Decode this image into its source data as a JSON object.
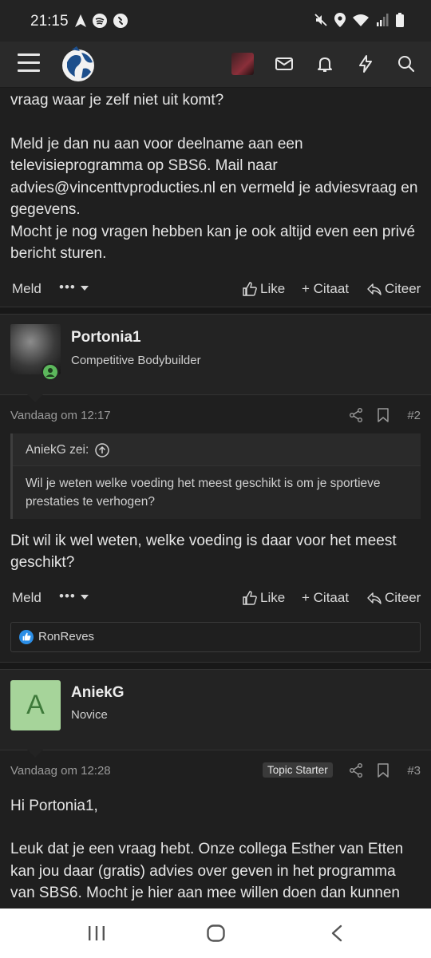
{
  "status_bar": {
    "time": "21:15",
    "left_icons": [
      "navigation-arrow-icon",
      "spotify-icon",
      "shazam-icon"
    ],
    "right_icons": [
      "mute-icon",
      "location-icon",
      "wifi-icon",
      "signal-icon",
      "battery-icon"
    ]
  },
  "top_nav": {
    "icons": [
      "menu-icon",
      "site-logo",
      "user-avatar",
      "inbox-icon",
      "bell-icon",
      "lightning-icon",
      "search-icon"
    ]
  },
  "post1": {
    "text_top": "vraag waar je zelf niet uit komt?",
    "text_body": "Meld je dan nu aan voor deelname aan een televisieprogramma op SBS6. Mail naar advies@vincenttvproducties.nl en vermeld je adviesvraag en gegevens.",
    "text_body2": "Mocht je nog vragen hebben kan je ook altijd even een privé bericht sturen.",
    "actions": {
      "report": "Meld",
      "more": "•••",
      "like": "Like",
      "quote": "+ Citaat",
      "reply": "Citeer"
    }
  },
  "post2": {
    "username": "Portonia1",
    "rank": "Competitive Bodybuilder",
    "date": "Vandaag om 12:17",
    "number": "#2",
    "quote_author": "AniekG zei:",
    "quote_text": "Wil je weten welke voeding het meest geschikt is om je sportieve prestaties te verhogen?",
    "text": "Dit wil ik wel weten, welke voeding is daar voor het meest geschikt?",
    "actions": {
      "report": "Meld",
      "more": "•••",
      "like": "Like",
      "quote": "+ Citaat",
      "reply": "Citeer"
    },
    "reaction_user": "RonReves"
  },
  "post3": {
    "avatar_letter": "A",
    "username": "AniekG",
    "rank": "Novice",
    "date": "Vandaag om 12:28",
    "badge": "Topic Starter",
    "number": "#3",
    "greeting": "Hi Portonia1,",
    "text": "Leuk dat je een vraag hebt. Onze collega Esther van Etten kan jou daar (gratis) advies over geven in het programma van SBS6. Mocht je hier aan mee willen doen dan kunnen"
  },
  "colors": {
    "background": "#1f1f1f",
    "header": "#2a2a2a",
    "online": "#5cb85c",
    "avatar_green": "#a6d49a",
    "like_blue": "#2b8ee6"
  }
}
